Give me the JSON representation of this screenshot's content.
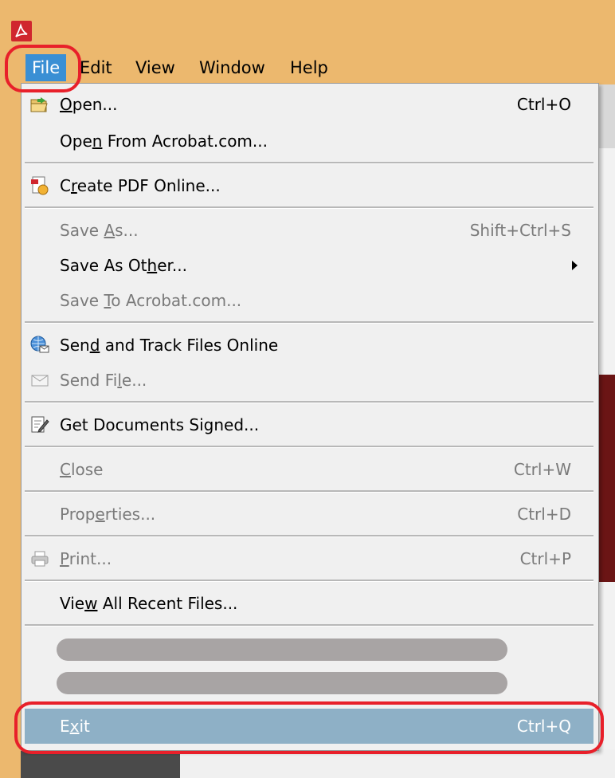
{
  "menubar": {
    "items": [
      {
        "label": "File",
        "active": true
      },
      {
        "label": "Edit",
        "active": false
      },
      {
        "label": "View",
        "active": false
      },
      {
        "label": "Window",
        "active": false
      },
      {
        "label": "Help",
        "active": false
      }
    ]
  },
  "file_menu": {
    "open": {
      "pre": "",
      "ul": "O",
      "post": "pen...",
      "shortcut": "Ctrl+O"
    },
    "open_acrobat": {
      "pre": "Ope",
      "ul": "n",
      "post": " From Acrobat.com..."
    },
    "create_pdf": {
      "pre": "C",
      "ul": "r",
      "post": "eate PDF Online..."
    },
    "save_as": {
      "pre": "Save ",
      "ul": "A",
      "post": "s...",
      "shortcut": "Shift+Ctrl+S"
    },
    "save_as_other": {
      "pre": "Save As Ot",
      "ul": "h",
      "post": "er..."
    },
    "save_to": {
      "pre": "Save ",
      "ul": "T",
      "post": "o Acrobat.com..."
    },
    "send_track": {
      "pre": "Sen",
      "ul": "d",
      "post": " and Track Files Online"
    },
    "send_file": {
      "pre": "Send Fi",
      "ul": "l",
      "post": "e..."
    },
    "get_signed": {
      "label": "Get Documents Signed..."
    },
    "close": {
      "pre": "",
      "ul": "C",
      "post": "lose",
      "shortcut": "Ctrl+W"
    },
    "properties": {
      "pre": "Prop",
      "ul": "e",
      "post": "rties...",
      "shortcut": "Ctrl+D"
    },
    "print": {
      "pre": "",
      "ul": "P",
      "post": "rint...",
      "shortcut": "Ctrl+P"
    },
    "view_recent": {
      "pre": "Vie",
      "ul": "w",
      "post": " All Recent Files..."
    },
    "exit": {
      "pre": "E",
      "ul": "x",
      "post": "it",
      "shortcut": "Ctrl+Q"
    }
  },
  "colors": {
    "titlebar": "#ecb86e",
    "menu_active": "#3a8fd4",
    "highlight": "#8eb0c6",
    "annotation": "#e8202a",
    "app_icon": "#d0262e"
  },
  "icons": {
    "app": "adobe-reader-icon",
    "open": "open-folder-icon",
    "create_pdf": "create-pdf-icon",
    "send_track": "globe-mail-icon",
    "send_file": "envelope-icon",
    "get_signed": "sign-document-icon",
    "print": "printer-icon"
  }
}
